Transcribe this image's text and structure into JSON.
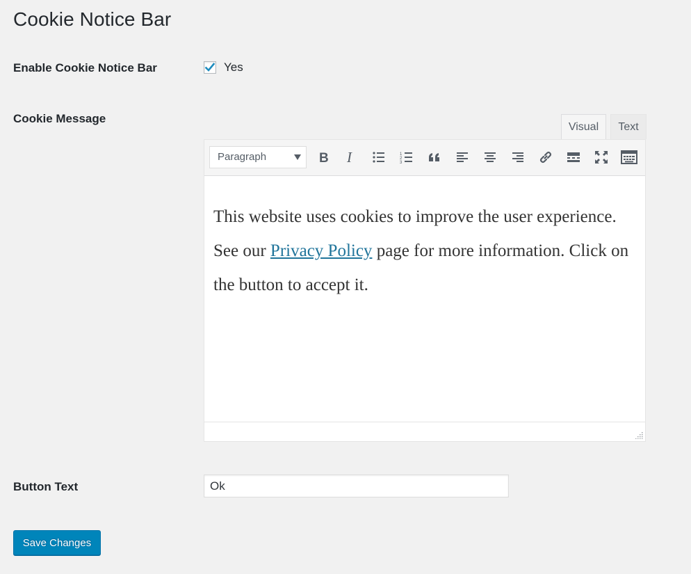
{
  "page": {
    "title": "Cookie Notice Bar"
  },
  "enable_row": {
    "label": "Enable Cookie Notice Bar",
    "checked": true,
    "checkbox_label": "Yes"
  },
  "message_row": {
    "label": "Cookie Message",
    "tabs": {
      "visual": "Visual",
      "text": "Text",
      "active": "visual"
    },
    "toolbar": {
      "format_select": "Paragraph",
      "buttons": [
        "bold-icon",
        "italic-icon",
        "bullet-list-icon",
        "numbered-list-icon",
        "blockquote-icon",
        "align-left-icon",
        "align-center-icon",
        "align-right-icon",
        "link-icon",
        "read-more-icon",
        "fullscreen-icon",
        "toolbar-toggle-icon"
      ]
    },
    "content": {
      "before_link": "This website uses cookies to improve the user experience. See our ",
      "link_text": "Privacy Policy",
      "after_link": " page for more information. Click on the button to accept it."
    }
  },
  "button_row": {
    "label": "Button Text",
    "value": "Ok"
  },
  "actions": {
    "save_label": "Save Changes"
  },
  "colors": {
    "primary": "#0085ba",
    "link": "#21759b",
    "check": "#1e8cbe",
    "background": "#f1f1f1"
  }
}
